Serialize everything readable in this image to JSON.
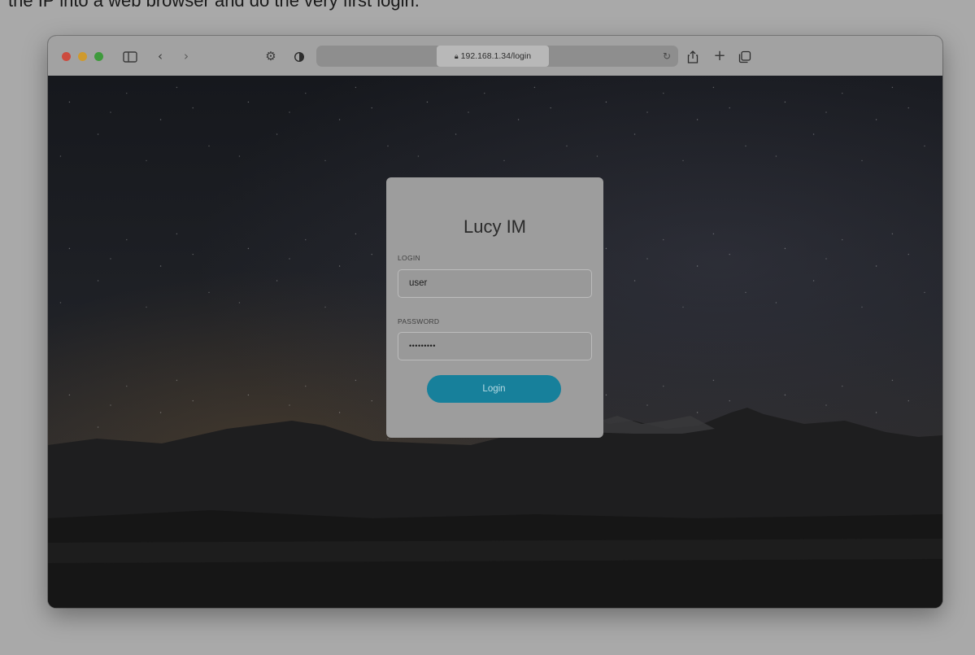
{
  "caption": "the IP into a web browser and do the very first login.",
  "browser": {
    "url": "192.168.1.34/login",
    "traffic_lights": [
      "#cc4b3f",
      "#cf9a2d",
      "#3e9a3c"
    ],
    "icons": [
      "sidebar-icon",
      "back-icon",
      "forward-icon",
      "settings-icon",
      "shield-icon",
      "lock-icon",
      "reload-icon",
      "share-icon",
      "new-tab-icon",
      "tabs-icon"
    ]
  },
  "login_card": {
    "title": "Lucy IM",
    "login_label": "LOGIN",
    "login_value": "user",
    "password_label": "PASSWORD",
    "password_value": "•••••••••",
    "button_label": "Login",
    "button_color": "#17809b"
  }
}
